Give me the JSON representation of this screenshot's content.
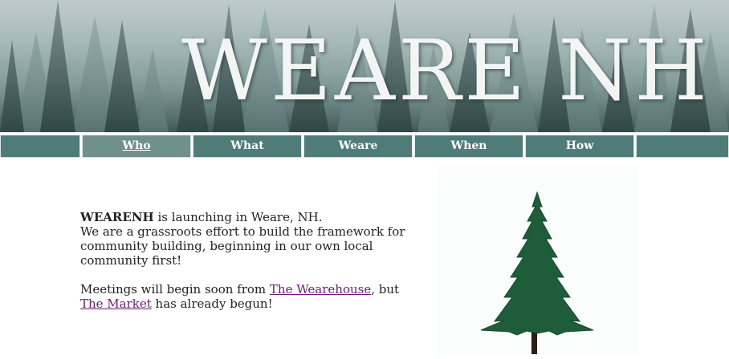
{
  "banner": {
    "title": "WEARE NH"
  },
  "nav": {
    "items": [
      {
        "label": "",
        "active": false
      },
      {
        "label": "Who",
        "active": true
      },
      {
        "label": "What",
        "active": false
      },
      {
        "label": "Weare",
        "active": false
      },
      {
        "label": "When",
        "active": false
      },
      {
        "label": "How",
        "active": false
      },
      {
        "label": "",
        "active": false
      }
    ]
  },
  "content": {
    "org_name": "WEARENH",
    "intro_rest": " is launching in Weare, NH.",
    "mission": "We are a grassroots effort to build the framework for community building, beginning in our own local community first!",
    "meetings_prefix": "Meetings will begin soon from ",
    "wearehouse_link": "The Wearehouse",
    "meetings_mid": ", but",
    "market_link": "The Market",
    "meetings_suffix": " has already begun!"
  },
  "colors": {
    "nav_background": "#4f7c79",
    "nav_active": "#6f908d",
    "link_visited": "#6b1a73",
    "tree_green": "#1f5c3a",
    "banner_text": "#f3f5f4"
  }
}
